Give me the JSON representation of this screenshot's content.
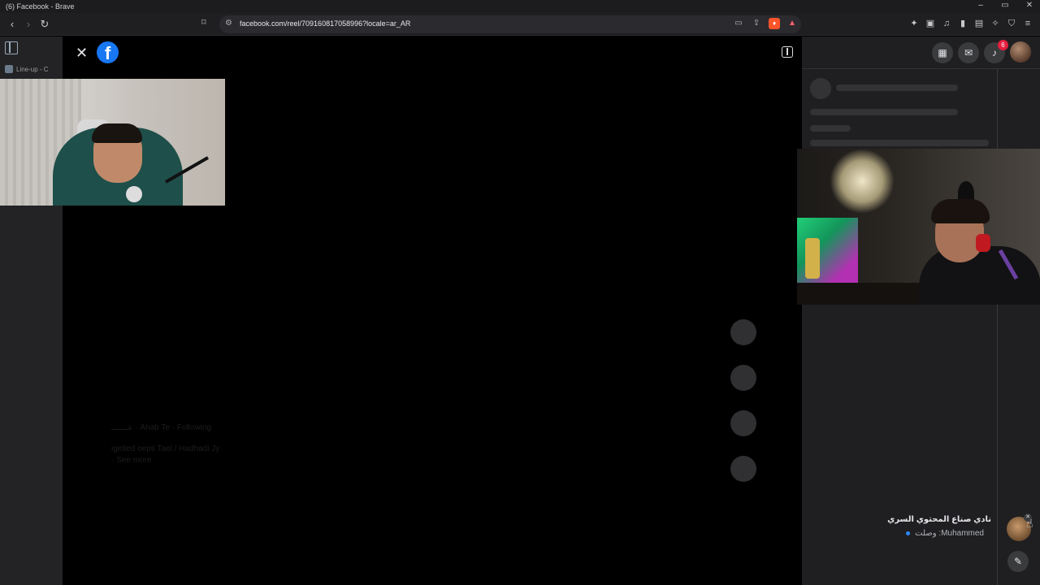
{
  "window": {
    "title": "(6) Facebook - Brave",
    "controls": [
      "–",
      "▭",
      "✕"
    ]
  },
  "toolbar": {
    "url": "facebook.com/reel/709160817058996?locale=ar_AR",
    "back_icon": "‹",
    "forward_icon": "›",
    "reload_icon": "↻",
    "bookmark_icon": "⌑"
  },
  "browser_sidebar": {
    "tab_label": "Line-up - C"
  },
  "reel": {
    "close_icon": "✕",
    "logo_letter": "f",
    "ghost_text_1": "عـــــــ · Ahab Te · Following",
    "ghost_text_2": "igeited oepti Tael / Hadhadi Jy",
    "ghost_text_3": "· See more"
  },
  "fb_header": {
    "notification_count": "6"
  },
  "chat_notification": {
    "title": "نادي صناع المحتوي السري",
    "message": "Muhammed: وصلت"
  },
  "colors": {
    "facebook_blue": "#1877f2",
    "badge_red": "#e41e3f",
    "unread_dot": "#2d88ff"
  }
}
